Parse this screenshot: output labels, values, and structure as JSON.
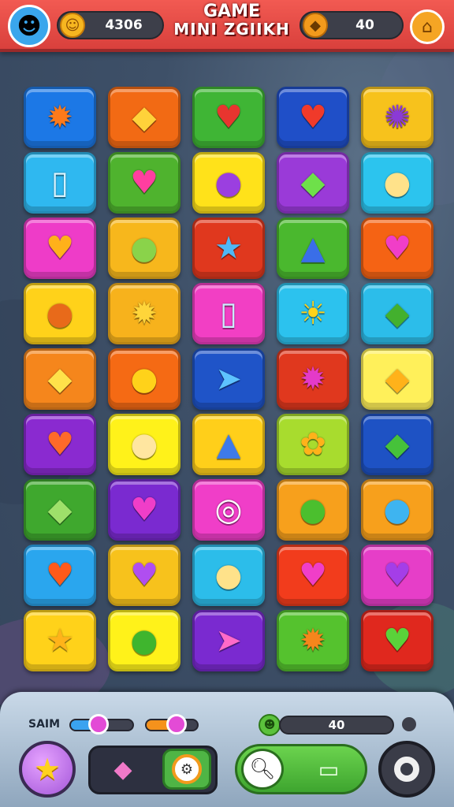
{
  "header": {
    "coins": "4306",
    "title_line1": "GAME",
    "title_line2": "MINI ZGIIKH",
    "gems": "40"
  },
  "grid": {
    "rows": [
      [
        {
          "name": "orange-flower",
          "glyph": "✹",
          "color": "#1c78e6",
          "iconColor": "#ff7a1a"
        },
        {
          "name": "yellow-gem",
          "glyph": "◆",
          "color": "#f26a14",
          "iconColor": "#ffd23a"
        },
        {
          "name": "heart-pencil",
          "glyph": "♥",
          "color": "#3fb535",
          "iconColor": "#e8352f"
        },
        {
          "name": "red-heart",
          "glyph": "♥",
          "color": "#1f4fc8",
          "iconColor": "#f03a2a"
        },
        {
          "name": "purple-gear",
          "glyph": "✺",
          "color": "#f7c21c",
          "iconColor": "#8b3ad6"
        }
      ],
      [
        {
          "name": "phone",
          "glyph": "▯",
          "color": "#2fb8f0",
          "iconColor": "#d9f4ff"
        },
        {
          "name": "pink-heart",
          "glyph": "♥",
          "color": "#4fb32e",
          "iconColor": "#ff3ea0"
        },
        {
          "name": "purple-ball",
          "glyph": "●",
          "color": "#ffe21a",
          "iconColor": "#9b3fe0"
        },
        {
          "name": "green-gem",
          "glyph": "◆",
          "color": "#9a3ad8",
          "iconColor": "#6ee04a"
        },
        {
          "name": "lollipop",
          "glyph": "●",
          "color": "#2cc4ee",
          "iconColor": "#ffe28a"
        }
      ],
      [
        {
          "name": "orange-heart",
          "glyph": "♥",
          "color": "#ee3cc8",
          "iconColor": "#ffb11a"
        },
        {
          "name": "leaf-ball",
          "glyph": "●",
          "color": "#f7b71c",
          "iconColor": "#8ad34a"
        },
        {
          "name": "blue-star",
          "glyph": "★",
          "color": "#e0381e",
          "iconColor": "#4fb8f5"
        },
        {
          "name": "rocket",
          "glyph": "▲",
          "color": "#4ab82e",
          "iconColor": "#3a6ee8"
        },
        {
          "name": "magenta-heart",
          "glyph": "♥",
          "color": "#f56314",
          "iconColor": "#f03ec8"
        }
      ],
      [
        {
          "name": "orange-ball",
          "glyph": "●",
          "color": "#ffd21a",
          "iconColor": "#e86a1a"
        },
        {
          "name": "blue-sun",
          "glyph": "✹",
          "color": "#f7b21c",
          "iconColor": "#ffd53a"
        },
        {
          "name": "phone",
          "glyph": "▯",
          "color": "#f23fc4",
          "iconColor": "#cdeeff"
        },
        {
          "name": "sun",
          "glyph": "☀",
          "color": "#2cc2ee",
          "iconColor": "#ffd21a"
        },
        {
          "name": "leaf",
          "glyph": "◆",
          "color": "#2cbdea",
          "iconColor": "#43b02e"
        }
      ],
      [
        {
          "name": "yellow-leaf",
          "glyph": "◆",
          "color": "#f5861c",
          "iconColor": "#ffe24a"
        },
        {
          "name": "lemon",
          "glyph": "●",
          "color": "#f56a14",
          "iconColor": "#ffd21a"
        },
        {
          "name": "paper-plane",
          "glyph": "➤",
          "color": "#1f54c8",
          "iconColor": "#5ec3ff"
        },
        {
          "name": "pink-flower",
          "glyph": "✹",
          "color": "#e0381e",
          "iconColor": "#e43ac8"
        },
        {
          "name": "cheese",
          "glyph": "◆",
          "color": "#fff05a",
          "iconColor": "#ffb21a"
        }
      ],
      [
        {
          "name": "orange-heart",
          "glyph": "♥",
          "color": "#8a2ad0",
          "iconColor": "#ff6a2a"
        },
        {
          "name": "lollipop",
          "glyph": "●",
          "color": "#fff21a",
          "iconColor": "#ffe6a0"
        },
        {
          "name": "rocket",
          "glyph": "▲",
          "color": "#ffcf1a",
          "iconColor": "#3e7ae8"
        },
        {
          "name": "yellow-flower",
          "glyph": "✿",
          "color": "#a8dc2e",
          "iconColor": "#ffb21a"
        },
        {
          "name": "green-leaf",
          "glyph": "◆",
          "color": "#1e52c4",
          "iconColor": "#46c23a"
        }
      ],
      [
        {
          "name": "leaf-berry",
          "glyph": "◆",
          "color": "#3fa82e",
          "iconColor": "#9ee06a"
        },
        {
          "name": "magenta-heart",
          "glyph": "♥",
          "color": "#7a2ad0",
          "iconColor": "#f03ec8"
        },
        {
          "name": "ring",
          "glyph": "◎",
          "color": "#f03ec8",
          "iconColor": "#ffffff"
        },
        {
          "name": "green-leaf",
          "glyph": "●",
          "color": "#f7a01c",
          "iconColor": "#4bbf2e"
        },
        {
          "name": "blue-balloon",
          "glyph": "●",
          "color": "#f7a01c",
          "iconColor": "#3eb4f0"
        }
      ],
      [
        {
          "name": "orange-heart",
          "glyph": "♥",
          "color": "#2aa6ee",
          "iconColor": "#ff5a1a"
        },
        {
          "name": "purple-heart",
          "glyph": "♥",
          "color": "#f7c21c",
          "iconColor": "#b04ef0"
        },
        {
          "name": "lollipop",
          "glyph": "●",
          "color": "#2cbdea",
          "iconColor": "#ffe28a"
        },
        {
          "name": "pink-heart",
          "glyph": "♥",
          "color": "#f23c1c",
          "iconColor": "#f03ec8"
        },
        {
          "name": "purple-heart",
          "glyph": "♥",
          "color": "#e63ec8",
          "iconColor": "#a43ee8"
        }
      ],
      [
        {
          "name": "yellow-star",
          "glyph": "★",
          "color": "#ffd21a",
          "iconColor": "#ffb31a"
        },
        {
          "name": "green-leaf",
          "glyph": "●",
          "color": "#fff21a",
          "iconColor": "#3fb52e"
        },
        {
          "name": "paper-plane",
          "glyph": "➤",
          "color": "#7a2ad0",
          "iconColor": "#ff6ac8"
        },
        {
          "name": "orange-flower",
          "glyph": "✹",
          "color": "#55c22e",
          "iconColor": "#f5861c"
        },
        {
          "name": "green-heart",
          "glyph": "♥",
          "color": "#e0281e",
          "iconColor": "#5ad23a"
        }
      ]
    ]
  },
  "bottom": {
    "label": "SAIM",
    "slider1_level": 0.45,
    "slider2_level": 0.6,
    "level_value": "40",
    "icons": {
      "star": "★",
      "gem": "◆",
      "gear": "⚙",
      "search": "🔍︎",
      "tv": "▭",
      "avatar": "☻",
      "coin": "☺",
      "gem_top": "◆",
      "home": "⌂",
      "level": "☻"
    }
  }
}
